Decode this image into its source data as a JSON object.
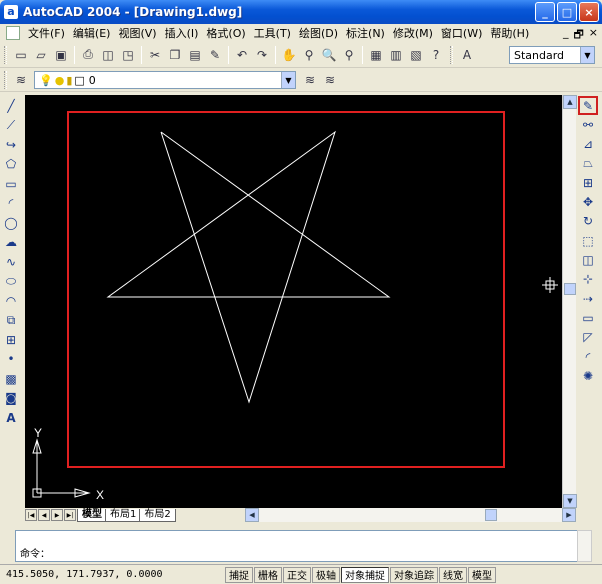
{
  "window": {
    "app_icon": "a",
    "title": "AutoCAD 2004 - [Drawing1.dwg]",
    "min": "_",
    "max": "□",
    "close": "×"
  },
  "menu": {
    "items": [
      "文件(F)",
      "编辑(E)",
      "视图(V)",
      "插入(I)",
      "格式(O)",
      "工具(T)",
      "绘图(D)",
      "标注(N)",
      "修改(M)",
      "窗口(W)",
      "帮助(H)"
    ],
    "mdi_min": "_",
    "mdi_restore": "🗗",
    "mdi_close": "×"
  },
  "toolbar": {
    "text_style": "Standard",
    "layer": "0"
  },
  "drawing": {
    "frame_color": "#E02020",
    "star_color": "#FFFFFF",
    "ucs_x": "X",
    "ucs_y": "Y"
  },
  "tabs": {
    "model": "模型",
    "layout1": "布局1",
    "layout2": "布局2"
  },
  "command": {
    "prompt": "命令："
  },
  "status": {
    "coords": "415.5050,  171.7937,  0.0000",
    "buttons": [
      "捕捉",
      "栅格",
      "正交",
      "极轴",
      "对象捕捉",
      "对象追踪",
      "线宽",
      "模型"
    ]
  }
}
